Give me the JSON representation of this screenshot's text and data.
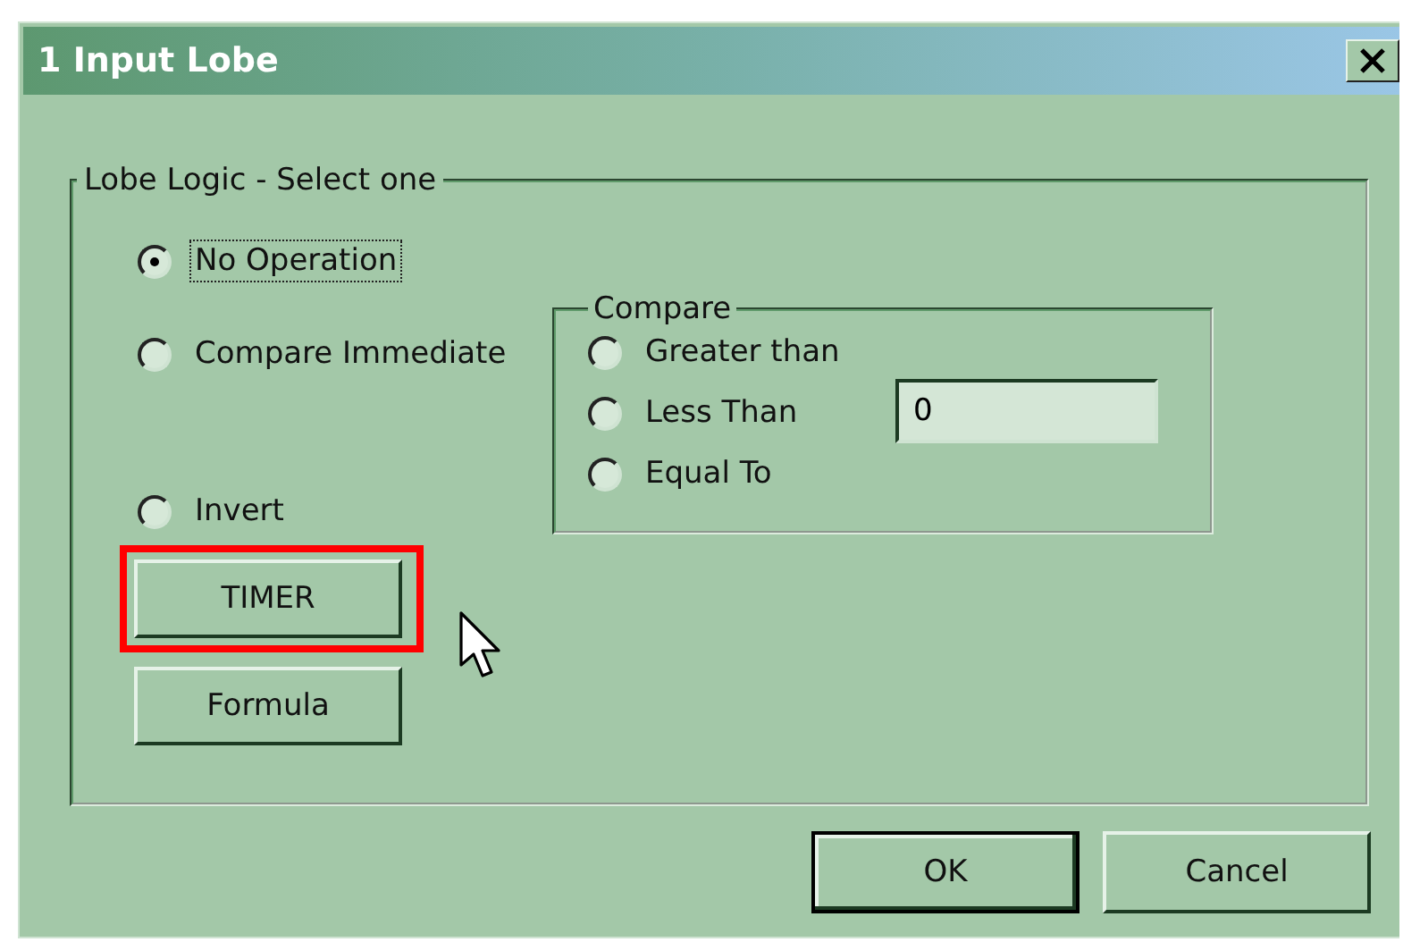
{
  "window": {
    "title": "1 Input Lobe"
  },
  "lobe_logic": {
    "title": "Lobe Logic - Select one",
    "options": [
      {
        "label": "No Operation",
        "selected": true,
        "focused": true
      },
      {
        "label": "Compare Immediate",
        "selected": false,
        "focused": false
      },
      {
        "label": "Invert",
        "selected": false,
        "focused": false
      }
    ]
  },
  "compare": {
    "title": "Compare",
    "options": [
      {
        "label": "Greater than",
        "selected": false
      },
      {
        "label": "Less Than",
        "selected": false
      },
      {
        "label": "Equal To",
        "selected": false
      }
    ],
    "value": "0"
  },
  "buttons": [
    {
      "label": "TIMER",
      "highlighted": true
    },
    {
      "label": "Formula",
      "highlighted": false
    }
  ],
  "dialog_buttons": [
    {
      "label": "OK",
      "default": true
    },
    {
      "label": "Cancel",
      "default": false
    }
  ]
}
